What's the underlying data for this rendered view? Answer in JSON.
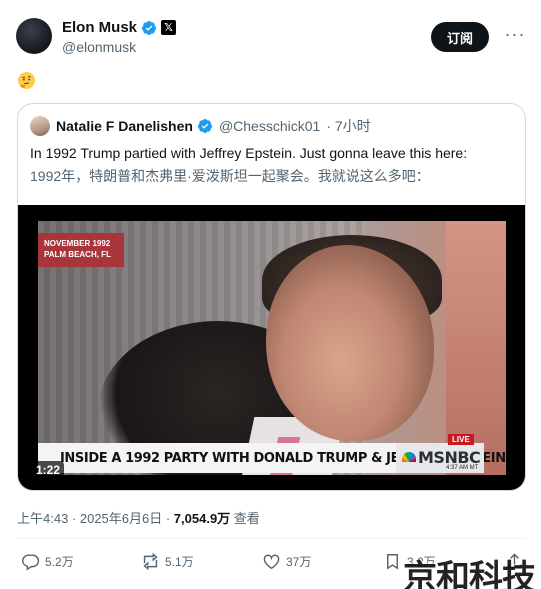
{
  "author": {
    "display_name": "Elon Musk",
    "handle": "@elonmusk",
    "x_badge": "𝕏"
  },
  "header_actions": {
    "subscribe_label": "订阅",
    "more_label": "···"
  },
  "post": {
    "emoji": "thinking-face-icon"
  },
  "quoted": {
    "display_name": "Natalie F Danelishen",
    "handle": "@Chesschick01",
    "time": "· 7小时",
    "text": "In 1992 Trump partied with Jeffrey Epstein. Just gonna leave this here:",
    "translation": "1992年，特朗普和杰弗里·爱泼斯坦一起聚会。我就说这么多吧：",
    "video": {
      "duration": "1:22",
      "date_line1": "NOVEMBER 1992",
      "date_line2": "PALM BEACH, FL",
      "lower_third": "INSIDE A 1992 PARTY WITH DONALD TRUMP & JEFFREY EPSTEIN",
      "live": "LIVE",
      "network": "MSNBC",
      "clock": "4:37 AM MT"
    }
  },
  "meta": {
    "time": "上午4:43 · 2025年6月6日 · ",
    "views": "7,054.9万",
    "views_suffix": " 查看"
  },
  "actions": {
    "replies": "5.2万",
    "reposts": "5.1万",
    "likes": "37万",
    "bookmarks": "3.2万"
  },
  "watermark": "京和科技",
  "colors": {
    "verified": "#1d9bf0",
    "text": "#0f1419",
    "secondary": "#536471",
    "border": "#cfd9de"
  }
}
